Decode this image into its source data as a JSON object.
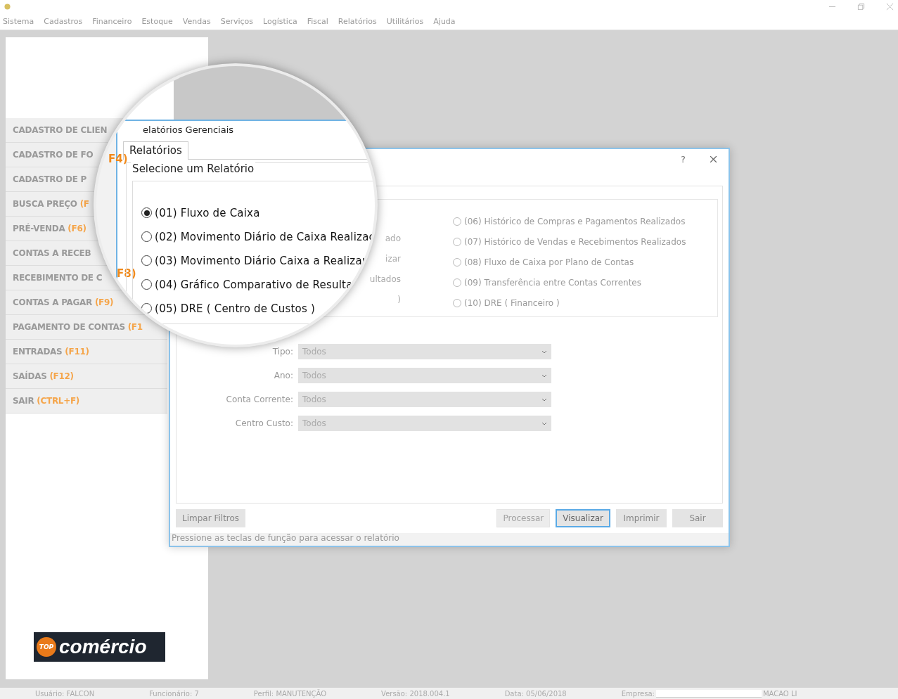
{
  "menu": [
    "Sistema",
    "Cadastros",
    "Financeiro",
    "Estoque",
    "Vendas",
    "Serviços",
    "Logística",
    "Fiscal",
    "Relatórios",
    "Utilitários",
    "Ajuda"
  ],
  "sidebar": [
    {
      "label": "CADASTRO DE CLIEN"
    },
    {
      "label": "CADASTRO DE FO"
    },
    {
      "label": "CADASTRO DE P"
    },
    {
      "label": "BUSCA PREÇO",
      "key": "(F"
    },
    {
      "label": "PRÉ-VENDA",
      "key": "(F6)"
    },
    {
      "label": "CONTAS A RECEB"
    },
    {
      "label": "RECEBIMENTO DE C"
    },
    {
      "label": "CONTAS A PAGAR",
      "key": "(F9)"
    },
    {
      "label": "PAGAMENTO DE CONTAS",
      "key": "(F1"
    },
    {
      "label": "ENTRADAS",
      "key": "(F11)"
    },
    {
      "label": "SAÍDAS",
      "key": "(F12)"
    },
    {
      "label": "SAIR",
      "key": "(CTRL+F)"
    }
  ],
  "logo": {
    "badge": "TOP",
    "name": "comércio"
  },
  "dialog": {
    "help": "?",
    "left_fragments": [
      "ado",
      "izar",
      "ultados",
      ")"
    ],
    "right_options": [
      {
        "label": "(06) Histórico de Compras e Pagamentos Realizados",
        "selected": false
      },
      {
        "label": "(07) Histórico de Vendas e Recebimentos Realizados",
        "selected": false
      },
      {
        "label": "(08) Fluxo de Caixa por Plano de Contas",
        "selected": false
      },
      {
        "label": "(09) Transferência entre Contas Correntes",
        "selected": false
      },
      {
        "label": "(10) DRE ( Financeiro )",
        "selected": false
      }
    ],
    "filters": [
      {
        "label": "Tipo:",
        "value": "Todos"
      },
      {
        "label": "Ano:",
        "value": "Todos"
      },
      {
        "label": "Conta Corrente:",
        "value": "Todos"
      },
      {
        "label": "Centro Custo:",
        "value": "Todos"
      }
    ],
    "clear_button": "Limpar Filtros",
    "buttons": [
      {
        "label": "Processar",
        "disabled": true,
        "focused": false
      },
      {
        "label": "Visualizar",
        "disabled": false,
        "focused": true
      },
      {
        "label": "Imprimir",
        "disabled": false,
        "focused": false
      },
      {
        "label": "Sair",
        "disabled": false,
        "focused": false
      }
    ],
    "status": "Pressione as teclas de função para acessar o relatório"
  },
  "magnifier": {
    "side_keys": [
      "F4)",
      "F8)"
    ],
    "title": "elatórios Gerenciais",
    "tab": {
      "label": "Relatórios",
      "selected": true
    },
    "group_title": "Selecione um Relatório",
    "options": [
      {
        "label": "(01) Fluxo de Caixa",
        "selected": true
      },
      {
        "label": "(02) Movimento Diário de Caixa Realizac",
        "selected": false
      },
      {
        "label": "(03) Movimento Diário Caixa a Realizar",
        "selected": false
      },
      {
        "label": "(04) Gráfico Comparativo de Resulta",
        "selected": false
      },
      {
        "label": "(05) DRE ( Centro de Custos )",
        "selected": false
      }
    ]
  },
  "status_bar": [
    {
      "kind": "text",
      "text": "Usuário: FALCON"
    },
    {
      "kind": "text",
      "text": "Funcionário: 7"
    },
    {
      "kind": "text",
      "text": "Perfil: MANUTENÇÃO"
    },
    {
      "kind": "text",
      "text": "Versão: 2018.004.1"
    },
    {
      "kind": "text",
      "text": "Data: 05/06/2018"
    },
    {
      "kind": "redacted",
      "text": "Empresa:",
      "tail": "MACAO LI"
    }
  ]
}
